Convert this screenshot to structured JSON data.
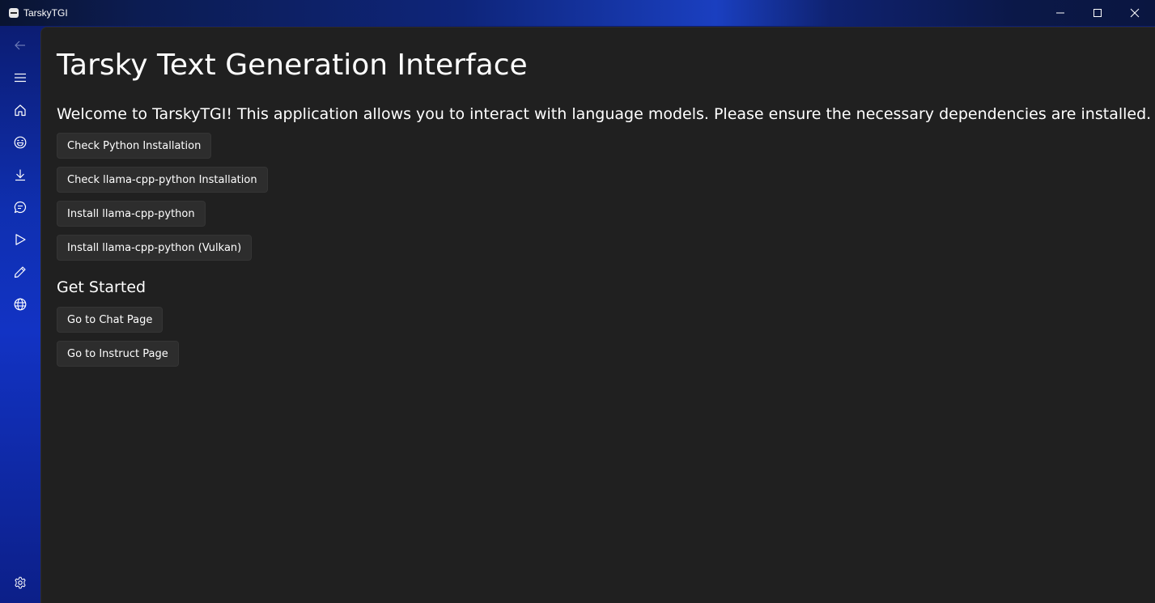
{
  "window": {
    "title": "TarskyTGI",
    "caption_icons": [
      "minimize-icon",
      "maximize-icon",
      "close-icon"
    ]
  },
  "nav": {
    "items": [
      {
        "name": "back",
        "icon": "back-arrow-icon"
      },
      {
        "name": "menu",
        "icon": "hamburger-menu-icon"
      },
      {
        "name": "home",
        "icon": "home-icon"
      },
      {
        "name": "models",
        "icon": "emoji-icon"
      },
      {
        "name": "download",
        "icon": "download-icon"
      },
      {
        "name": "chat",
        "icon": "chat-bubble-icon"
      },
      {
        "name": "instruct",
        "icon": "play-icon"
      },
      {
        "name": "edit",
        "icon": "pencil-icon"
      },
      {
        "name": "web",
        "icon": "globe-icon"
      },
      {
        "name": "settings",
        "icon": "gear-icon"
      }
    ]
  },
  "main": {
    "title": "Tarsky Text Generation Interface",
    "welcome": "Welcome to TarskyTGI! This application allows you to interact with language models. Please ensure the necessary dependencies are installed.",
    "dependency_buttons": [
      "Check Python Installation",
      "Check llama-cpp-python Installation",
      "Install llama-cpp-python",
      "Install llama-cpp-python (Vulkan)"
    ],
    "get_started_heading": "Get Started",
    "get_started_buttons": [
      "Go to Chat Page",
      "Go to Instruct Page"
    ]
  },
  "colors": {
    "content_bg": "#202020",
    "button_bg": "#2d2d2d",
    "text": "#ffffff",
    "accent_blue": "#1233c4"
  }
}
